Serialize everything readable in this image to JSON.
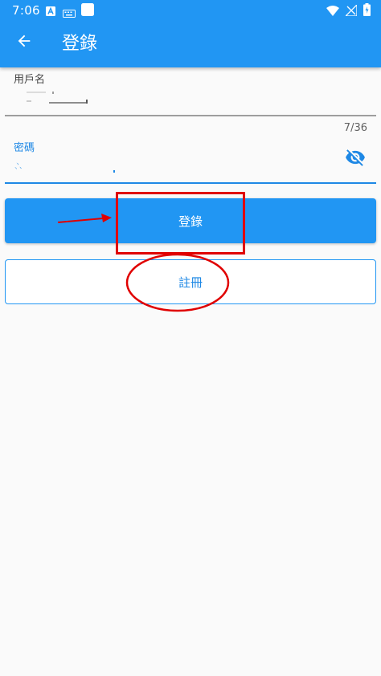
{
  "status_bar": {
    "time": "7:06",
    "left_icons": [
      "android-notification-icon",
      "keyboard-icon",
      "square-notification-icon"
    ],
    "right_icons": [
      "wifi-icon",
      "no-signal-icon",
      "battery-charging-icon"
    ]
  },
  "toolbar": {
    "title": "登錄",
    "back_icon": "arrow-left-icon"
  },
  "username_field": {
    "label": "用戶名"
  },
  "password_field": {
    "label": "密碼",
    "value": "𠁼",
    "counter": "7/36",
    "toggle_icon": "eye-off-icon"
  },
  "buttons": {
    "login_label": "登錄",
    "register_label": "註冊"
  },
  "colors": {
    "primary": "#2196f3",
    "annotation_red": "#e00000",
    "background": "#fafafa"
  }
}
